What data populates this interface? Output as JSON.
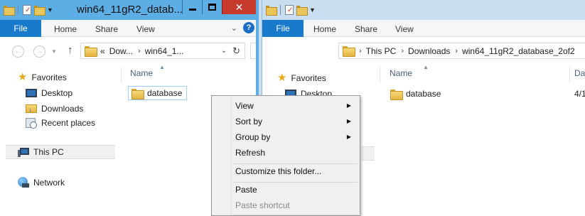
{
  "left_window": {
    "title": "win64_11gR2_datab...",
    "ribbon": {
      "file": "File",
      "home": "Home",
      "share": "Share",
      "view": "View",
      "help": "?"
    },
    "address": {
      "overflow": "«",
      "crumbs": [
        "Dow...",
        "win64_1..."
      ]
    },
    "column_header": "Name",
    "nav_pane": {
      "favorites": "Favorites",
      "items": [
        "Desktop",
        "Downloads",
        "Recent places"
      ],
      "this_pc": "This PC",
      "network": "Network"
    },
    "files": [
      "database"
    ]
  },
  "right_window": {
    "ribbon": {
      "file": "File",
      "home": "Home",
      "share": "Share",
      "view": "View"
    },
    "address": {
      "crumbs": [
        "This PC",
        "Downloads",
        "win64_11gR2_database_2of2"
      ]
    },
    "column_headers": [
      "Name",
      "Dat"
    ],
    "nav_pane": {
      "favorites": "Favorites",
      "items": [
        "Desktop"
      ]
    },
    "files": [
      {
        "name": "database",
        "date": "4/1"
      }
    ]
  },
  "context_menu": {
    "items": [
      {
        "label": "View",
        "submenu": true
      },
      {
        "label": "Sort by",
        "submenu": true
      },
      {
        "label": "Group by",
        "submenu": true
      },
      {
        "label": "Refresh",
        "submenu": false
      },
      {
        "label": "Customize this folder...",
        "submenu": false
      },
      {
        "label": "Paste",
        "submenu": false
      },
      {
        "label": "Paste shortcut",
        "submenu": false,
        "disabled": true
      }
    ]
  },
  "colors": {
    "accent": "#1979ca",
    "active_title": "#5eaee6",
    "close": "#c7392b",
    "inactive_title": "#c9dff1"
  },
  "icons": [
    "folder-icon",
    "star-icon",
    "monitor-icon",
    "downloads-icon",
    "recent-places-icon",
    "pc-icon",
    "network-icon",
    "help-icon",
    "refresh-icon",
    "up-arrow-icon"
  ]
}
